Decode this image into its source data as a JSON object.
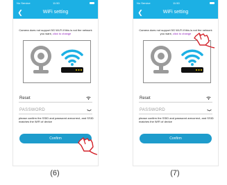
{
  "colors": {
    "header": "#1cb0e4",
    "button": "#1e9ccc",
    "link": "#8e1bb9"
  },
  "icons": [
    "back-icon",
    "camera-icon",
    "wifi-router-icon",
    "wifi-icon",
    "eye-icon",
    "hand-pointer-icon",
    "battery-icon"
  ],
  "screens": [
    {
      "caption": "(6)",
      "status": {
        "carrier": "No Service",
        "time": "11:50"
      },
      "title": "WiFi setting",
      "warning": "Camera does not support 5G Wi-Fi.If this is not the network you want,",
      "warning_link": "click to change",
      "ssid_value": "Reset",
      "password_placeholder": "PASSWORD",
      "hint": "please confirm the SSID and password arecorrect, and SSID matches the WiFi of device",
      "confirm_label": "Confirm"
    },
    {
      "caption": "(7)",
      "status": {
        "carrier": "No Service",
        "time": "11:50"
      },
      "title": "WiFi setting",
      "warning": "Camera does not support 5G Wi-Fi.If this is not the network you want,",
      "warning_link": "click to change",
      "ssid_value": "Reset",
      "password_placeholder": "PASSWORD",
      "hint": "please confirm the SSID and password arecorrect, and SSID matches the WiFi of device",
      "confirm_label": "Confirm"
    }
  ]
}
